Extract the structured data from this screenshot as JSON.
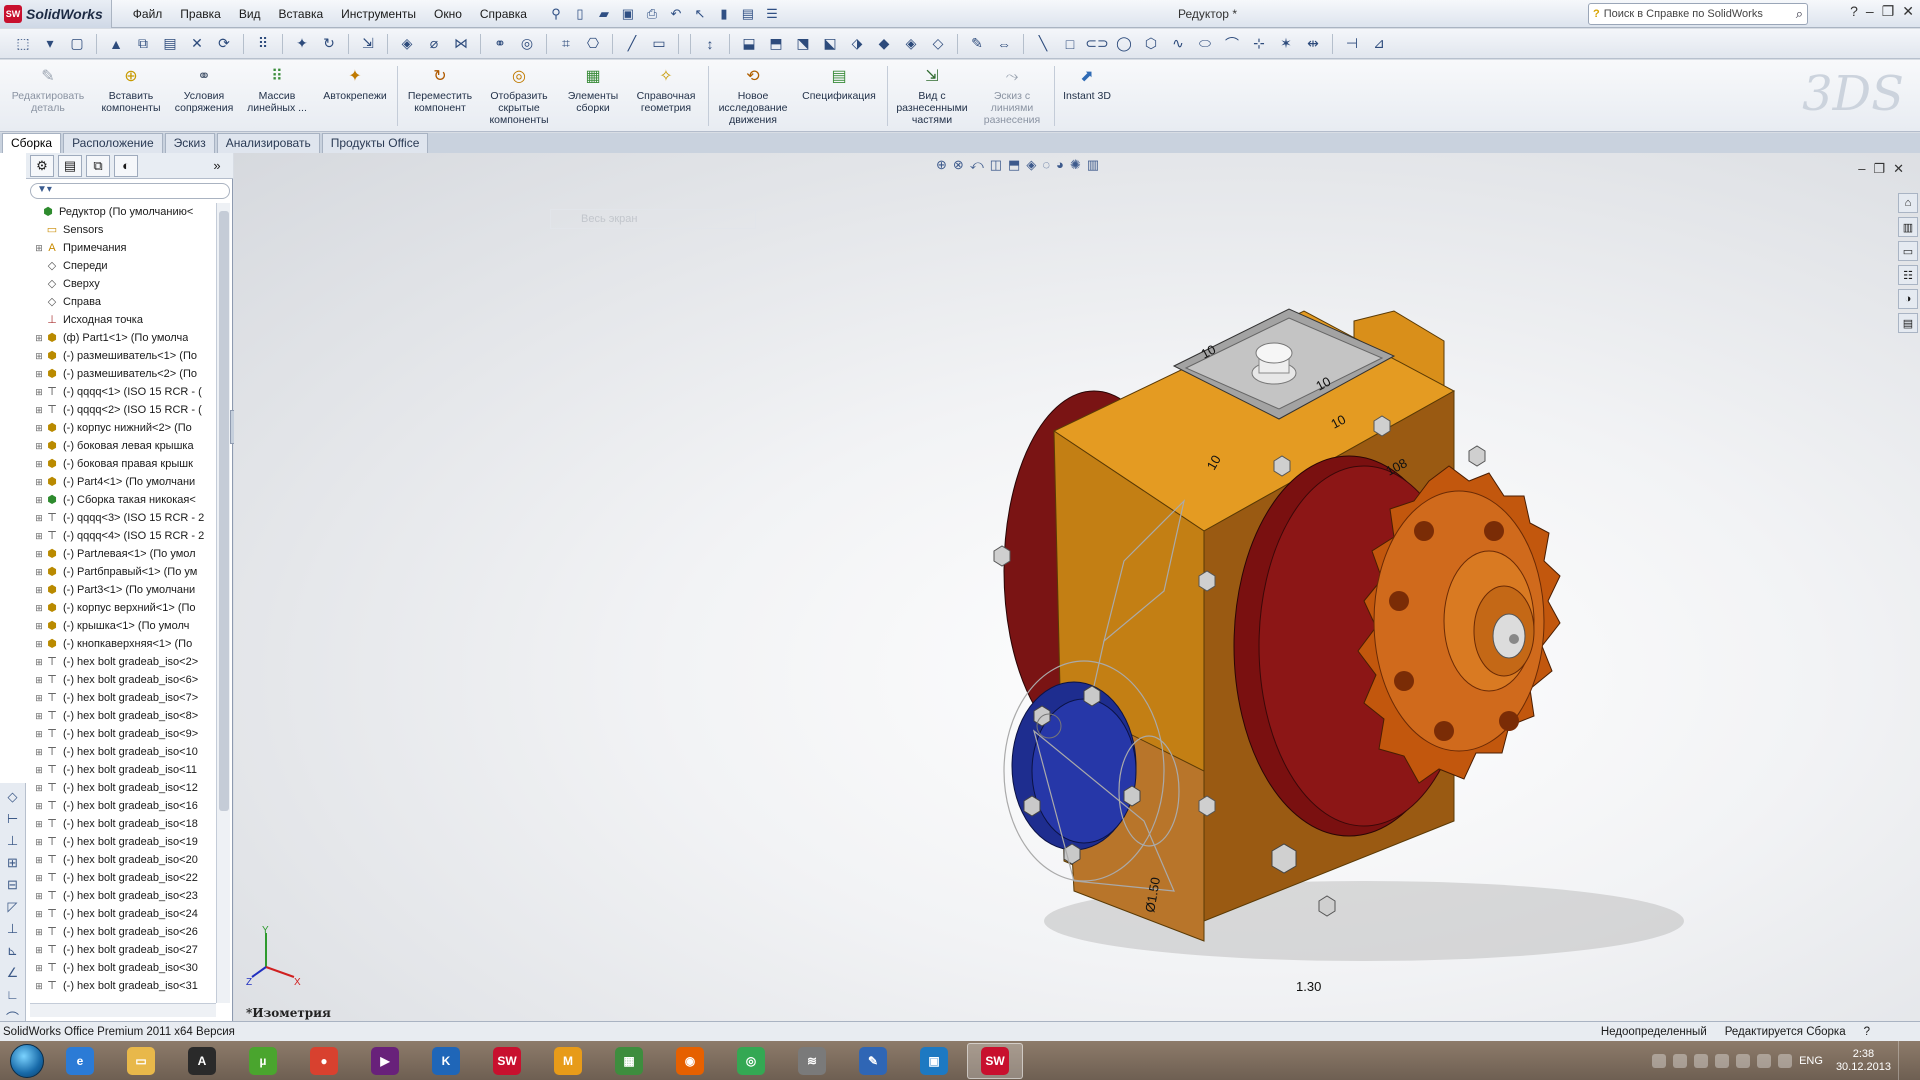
{
  "app": {
    "name": "SolidWorks",
    "logo_mark": "SW",
    "document_title": "Редуктор *"
  },
  "menu": [
    "Файл",
    "Правка",
    "Вид",
    "Вставка",
    "Инструменты",
    "Окно",
    "Справка"
  ],
  "search": {
    "placeholder": "Поиск в Справке по SolidWorks"
  },
  "command_manager": {
    "buttons": [
      {
        "label": "Редактировать деталь",
        "icon": "edit-part-icon",
        "dim": true
      },
      {
        "label": "Вставить компоненты",
        "icon": "insert-components-icon"
      },
      {
        "label": "Условия сопряжения",
        "icon": "mate-icon"
      },
      {
        "label": "Массив линейных ...",
        "icon": "linear-pattern-icon"
      },
      {
        "label": "Автокрепежи",
        "icon": "smart-fasteners-icon"
      },
      {
        "label": "Переместить компонент",
        "icon": "move-component-icon"
      },
      {
        "label": "Отобразить скрытые компоненты",
        "icon": "show-hidden-icon"
      },
      {
        "label": "Элементы сборки",
        "icon": "assembly-features-icon"
      },
      {
        "label": "Справочная геометрия",
        "icon": "reference-geometry-icon"
      },
      {
        "label": "Новое исследование движения",
        "icon": "motion-study-icon"
      },
      {
        "label": "Спецификация",
        "icon": "bom-icon"
      },
      {
        "label": "Вид с разнесенными частями",
        "icon": "exploded-view-icon"
      },
      {
        "label": "Эскиз с линиями разнесения",
        "icon": "explode-line-sketch-icon",
        "dim": true
      },
      {
        "label": "Instant 3D",
        "icon": "instant3d-icon"
      }
    ]
  },
  "tabs": [
    "Сборка",
    "Расположение",
    "Эскиз",
    "Анализировать",
    "Продукты Office"
  ],
  "active_tab": "Сборка",
  "tree": {
    "root": "Редуктор  (По умолчанию<",
    "items": [
      {
        "label": "Sensors",
        "icon": "sensors-icon",
        "expand": false
      },
      {
        "label": "Примечания",
        "icon": "annotations-icon",
        "expand": true
      },
      {
        "label": "Спереди",
        "icon": "plane-icon",
        "expand": false
      },
      {
        "label": "Сверху",
        "icon": "plane-icon",
        "expand": false
      },
      {
        "label": "Справа",
        "icon": "plane-icon",
        "expand": false
      },
      {
        "label": "Исходная точка",
        "icon": "origin-icon",
        "expand": false
      },
      {
        "label": "(ф) Part1<1> (По умолча",
        "icon": "part-icon",
        "expand": true
      },
      {
        "label": "(-) размешиватель<1> (По",
        "icon": "part-icon",
        "expand": true
      },
      {
        "label": "(-) размешиватель<2> (По",
        "icon": "part-icon",
        "expand": true
      },
      {
        "label": "(-) qqqq<1> (ISO 15 RCR - (",
        "icon": "bolt-icon",
        "expand": true
      },
      {
        "label": "(-) qqqq<2> (ISO 15 RCR - (",
        "icon": "bolt-icon",
        "expand": true
      },
      {
        "label": "(-) корпус нижний<2> (По",
        "icon": "part-icon",
        "expand": true
      },
      {
        "label": "(-) боковая левая крышка",
        "icon": "part-icon",
        "expand": true
      },
      {
        "label": "(-) боковая правая крышк",
        "icon": "part-icon",
        "expand": true
      },
      {
        "label": "(-) Part4<1> (По умолчани",
        "icon": "part-icon",
        "expand": true
      },
      {
        "label": "(-) Сборка такая никокая<",
        "icon": "subassembly-icon",
        "expand": true
      },
      {
        "label": "(-) qqqq<3> (ISO 15 RCR - 2",
        "icon": "bolt-icon",
        "expand": true
      },
      {
        "label": "(-) qqqq<4> (ISO 15 RCR - 2",
        "icon": "bolt-icon",
        "expand": true
      },
      {
        "label": "(-) Partлевая<1> (По умол",
        "icon": "part-icon",
        "expand": true
      },
      {
        "label": "(-) Partбправый<1> (По ум",
        "icon": "part-icon",
        "expand": true
      },
      {
        "label": "(-) Part3<1> (По умолчани",
        "icon": "part-icon",
        "expand": true
      },
      {
        "label": "(-) корпус верхний<1> (По",
        "icon": "part-icon",
        "expand": true
      },
      {
        "label": "(-) крышка<1> (По умолч",
        "icon": "part-icon",
        "expand": true
      },
      {
        "label": "(-) кнопкаверхняя<1> (По",
        "icon": "part-icon",
        "expand": true
      },
      {
        "label": "(-) hex bolt gradeab_iso<2>",
        "icon": "bolt-icon",
        "expand": true
      },
      {
        "label": "(-) hex bolt gradeab_iso<6>",
        "icon": "bolt-icon",
        "expand": true
      },
      {
        "label": "(-) hex bolt gradeab_iso<7>",
        "icon": "bolt-icon",
        "expand": true
      },
      {
        "label": "(-) hex bolt gradeab_iso<8>",
        "icon": "bolt-icon",
        "expand": true
      },
      {
        "label": "(-) hex bolt gradeab_iso<9>",
        "icon": "bolt-icon",
        "expand": true
      },
      {
        "label": "(-) hex bolt gradeab_iso<10",
        "icon": "bolt-icon",
        "expand": true
      },
      {
        "label": "(-) hex bolt gradeab_iso<11",
        "icon": "bolt-icon",
        "expand": true
      },
      {
        "label": "(-) hex bolt gradeab_iso<12",
        "icon": "bolt-icon",
        "expand": true
      },
      {
        "label": "(-) hex bolt gradeab_iso<16",
        "icon": "bolt-icon",
        "expand": true
      },
      {
        "label": "(-) hex bolt gradeab_iso<18",
        "icon": "bolt-icon",
        "expand": true
      },
      {
        "label": "(-) hex bolt gradeab_iso<19",
        "icon": "bolt-icon",
        "expand": true
      },
      {
        "label": "(-) hex bolt gradeab_iso<20",
        "icon": "bolt-icon",
        "expand": true
      },
      {
        "label": "(-) hex bolt gradeab_iso<22",
        "icon": "bolt-icon",
        "expand": true
      },
      {
        "label": "(-) hex bolt gradeab_iso<23",
        "icon": "bolt-icon",
        "expand": true
      },
      {
        "label": "(-) hex bolt gradeab_iso<24",
        "icon": "bolt-icon",
        "expand": true
      },
      {
        "label": "(-) hex bolt gradeab_iso<26",
        "icon": "bolt-icon",
        "expand": true
      },
      {
        "label": "(-) hex bolt gradeab_iso<27",
        "icon": "bolt-icon",
        "expand": true
      },
      {
        "label": "(-) hex bolt gradeab_iso<30",
        "icon": "bolt-icon",
        "expand": true
      },
      {
        "label": "(-) hex bolt gradeab_iso<31",
        "icon": "bolt-icon",
        "expand": true
      }
    ]
  },
  "viewport": {
    "hint": "Весь экран",
    "view_label": "*Изометрия",
    "dimensions": [
      "10",
      "10",
      "10",
      "10",
      "108",
      "Ø1.50",
      "1.30"
    ],
    "triad": {
      "x": "X",
      "y": "Y",
      "z": "Z"
    }
  },
  "status": {
    "product": "SolidWorks Office Premium 2011 x64 Версия",
    "state": "Недоопределенный",
    "mode": "Редактируется Сборка"
  },
  "taskbar": {
    "apps": [
      {
        "icon": "ie-icon",
        "color": "#2b7bd6",
        "glyph": "e"
      },
      {
        "icon": "explorer-icon",
        "color": "#e8b84a",
        "glyph": "▭"
      },
      {
        "icon": "archicad-icon",
        "color": "#2a2a2a",
        "glyph": "A"
      },
      {
        "icon": "utorrent-icon",
        "color": "#4aa52e",
        "glyph": "µ"
      },
      {
        "icon": "chrome-icon",
        "color": "#d8412f",
        "glyph": "●"
      },
      {
        "icon": "visual-studio-icon",
        "color": "#68217a",
        "glyph": "▶"
      },
      {
        "icon": "kompas-icon",
        "color": "#1f66b8",
        "glyph": "K"
      },
      {
        "icon": "solidworks-icon",
        "color": "#c8102e",
        "glyph": "SW"
      },
      {
        "icon": "mathcad-icon",
        "color": "#e79b19",
        "glyph": "M"
      },
      {
        "icon": "office-icon",
        "color": "#3e8d3e",
        "glyph": "▦"
      },
      {
        "icon": "firefox-icon",
        "color": "#e66000",
        "glyph": "◉"
      },
      {
        "icon": "network-icon",
        "color": "#34a853",
        "glyph": "◎"
      },
      {
        "icon": "wifi-app-icon",
        "color": "#7a7a7a",
        "glyph": "≋"
      },
      {
        "icon": "pdf-editor-icon",
        "color": "#2f66b5",
        "glyph": "✎"
      },
      {
        "icon": "image-viewer-icon",
        "color": "#1d79c2",
        "glyph": "▣"
      },
      {
        "icon": "solidworks-active-icon",
        "color": "#c8102e",
        "glyph": "SW",
        "active": true
      }
    ],
    "language": "ENG",
    "time": "2:38",
    "date": "30.12.2013"
  }
}
